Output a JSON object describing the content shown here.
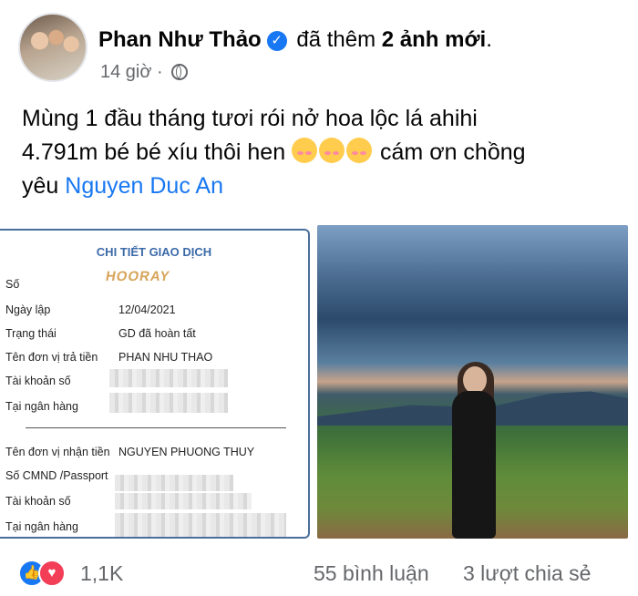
{
  "post": {
    "author": "Phan Như Thảo",
    "action_text": "đã thêm",
    "action_bold": "2 ảnh mới",
    "action_end": ".",
    "time": "14 giờ ·",
    "caption_line1": "Mùng 1 đầu tháng tươi rói nở hoa lộc lá ahihi",
    "caption_line2a": "4.791m bé bé xíu thôi hen",
    "caption_line2b": "cám ơn chồng",
    "caption_line3a": "yêu",
    "mention": "Nguyen Duc An"
  },
  "receipt": {
    "title": "CHI TIẾT GIAO DỊCH",
    "stamp": "HOORAY",
    "rows": [
      {
        "label": "Số",
        "value": ""
      },
      {
        "label": "Ngày lập",
        "value": "12/04/2021"
      },
      {
        "label": "Trạng thái",
        "value": "GD đã hoàn tất"
      },
      {
        "label": "Tên đơn vị trả tiền",
        "value": "PHAN NHU THAO"
      },
      {
        "label": "Tài khoản số",
        "value": ""
      },
      {
        "label": "Tại ngân hàng",
        "value": ""
      },
      {
        "label": "Tên đơn vị nhận tiền",
        "value": "NGUYEN PHUONG THUY"
      },
      {
        "label": "Số CMND /Passport",
        "value": ""
      },
      {
        "label": "Tài khoản số",
        "value": ""
      },
      {
        "label": "Tại ngân hàng",
        "value": ""
      }
    ]
  },
  "footer": {
    "reactions": "1,1K",
    "comments": "55 bình luận",
    "shares": "3 lượt chia sẻ"
  },
  "icons": [
    "verified-badge-icon",
    "globe-icon",
    "like-icon",
    "love-icon",
    "blush-emoji-icon"
  ],
  "colors": {
    "accent": "#1877f2",
    "love": "#f33e58",
    "meta": "#65676b"
  }
}
